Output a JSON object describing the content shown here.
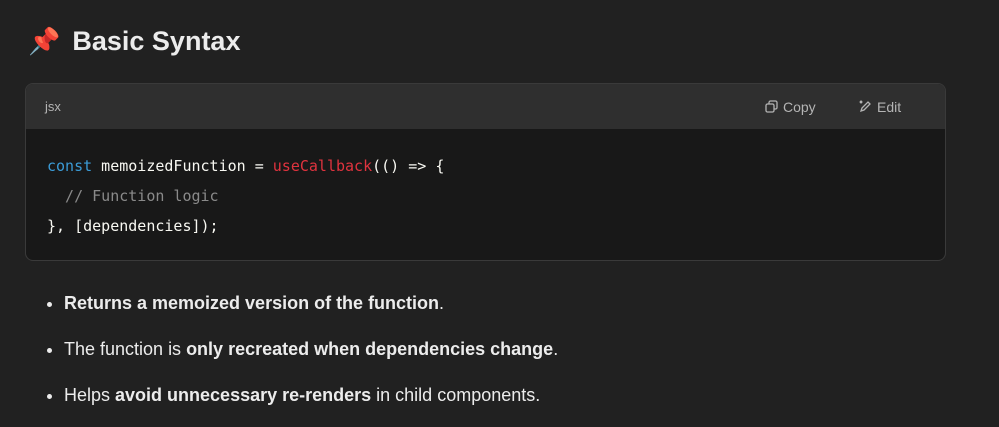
{
  "heading": {
    "icon": "pushpin-icon",
    "emoji": "📌",
    "title": "Basic Syntax"
  },
  "code_block": {
    "language": "jsx",
    "copy_label": "Copy",
    "edit_label": "Edit",
    "lines": [
      {
        "kw": "const",
        "plain1": " memoizedFunction = ",
        "fn": "useCallback",
        "plain2": "(() => {"
      },
      {
        "comment": "  // Function logic"
      },
      {
        "plain": "}, [dependencies]);"
      }
    ]
  },
  "bullets": [
    {
      "bold": "Returns a memoized version of the function",
      "after": "."
    },
    {
      "before": "The function is ",
      "bold": "only recreated when dependencies change",
      "after": "."
    },
    {
      "before": "Helps ",
      "bold": "avoid unnecessary re-renders",
      "after": " in child components."
    }
  ]
}
